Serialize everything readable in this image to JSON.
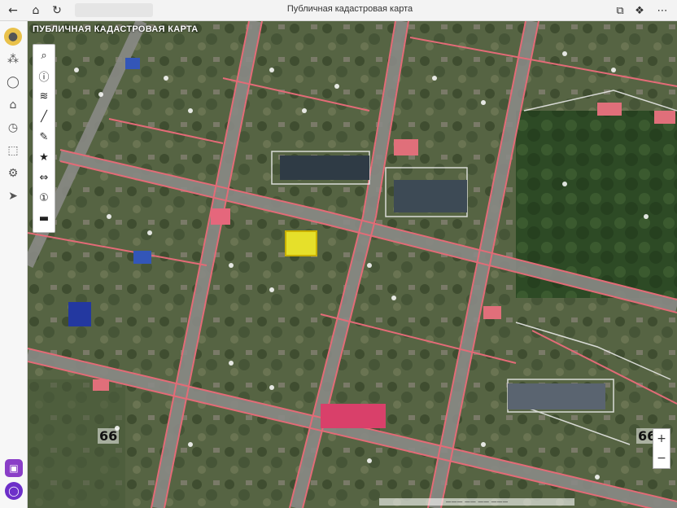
{
  "browser": {
    "page_title": "Публичная кадастровая карта",
    "back_icon": "arrow-left-icon",
    "home_icon": "home-icon",
    "reload_icon": "reload-icon",
    "extensions": [
      "bookmark-icon",
      "collections-icon",
      "profile-icon"
    ],
    "menu_icon": "menu-dots-icon"
  },
  "sidebar": {
    "items": [
      "profile-icon",
      "apps-icon",
      "bell-icon",
      "home-icon",
      "history-icon",
      "downloads-icon",
      "settings-icon",
      "navigation-icon"
    ],
    "bottom": [
      "calendar-icon",
      "ring-icon"
    ]
  },
  "map": {
    "title": "ПУБЛИЧНАЯ КАДАСТРОВАЯ КАРТА",
    "tools": [
      {
        "icon": "search-icon",
        "glyph": "⌕"
      },
      {
        "icon": "info-icon",
        "glyph": "ⓘ"
      },
      {
        "icon": "layers-icon",
        "glyph": "≋"
      },
      {
        "icon": "ruler-icon",
        "glyph": "╱"
      },
      {
        "icon": "draw-icon",
        "glyph": "✎"
      },
      {
        "icon": "star-icon",
        "glyph": "★"
      },
      {
        "icon": "measure-icon",
        "glyph": "⇔"
      },
      {
        "icon": "help-icon",
        "glyph": "①"
      },
      {
        "icon": "legend-icon",
        "glyph": "▬"
      }
    ],
    "zoom_in": "+",
    "zoom_out": "−",
    "block_numbers": [
      "66",
      "66"
    ],
    "scale_text": "——— —— —— ———"
  }
}
